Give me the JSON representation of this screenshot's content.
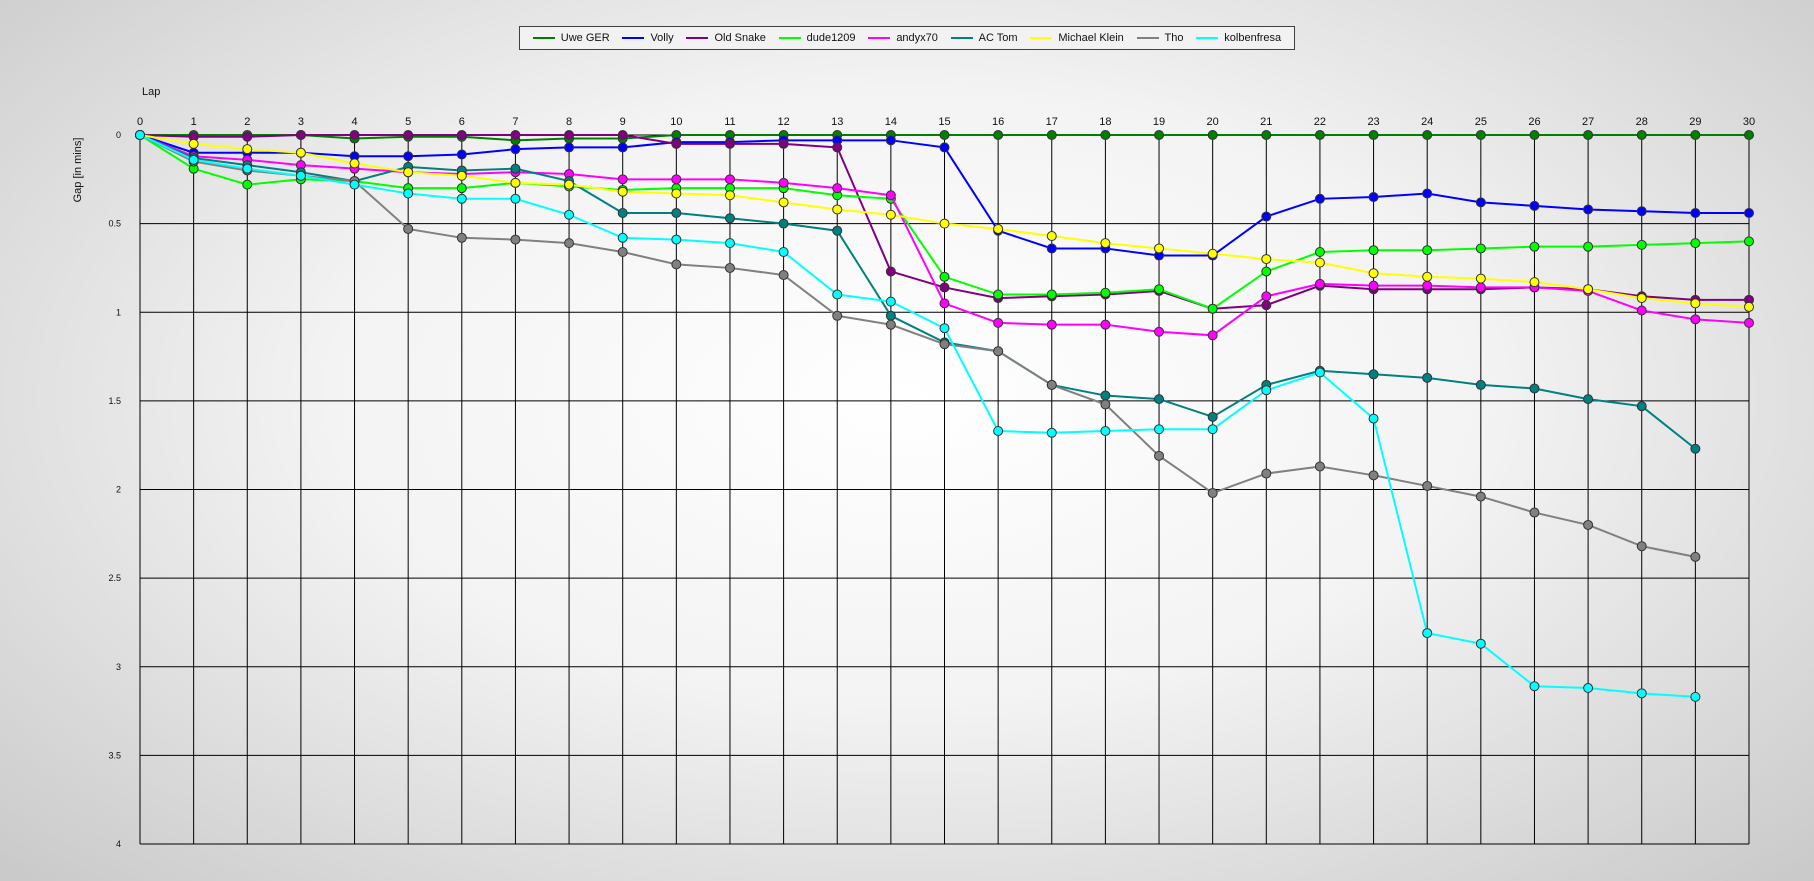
{
  "chart_data": {
    "type": "line",
    "title": "",
    "xlabel": "Lap",
    "ylabel": "Gap [in mins]",
    "x": [
      0,
      1,
      2,
      3,
      4,
      5,
      6,
      7,
      8,
      9,
      10,
      11,
      12,
      13,
      14,
      15,
      16,
      17,
      18,
      19,
      20,
      21,
      22,
      23,
      24,
      25,
      26,
      27,
      28,
      29,
      30
    ],
    "xlim": [
      0,
      30
    ],
    "ylim": [
      0,
      4
    ],
    "y_inverted": true,
    "y_ticks": [
      "0",
      "0.5",
      "1",
      "1.5",
      "2",
      "2.5",
      "3",
      "3.5",
      "4"
    ],
    "grid": true,
    "legend_position": "top-center",
    "series": [
      {
        "name": "Uwe GER",
        "color": "#008000",
        "values": [
          0,
          0,
          0,
          0,
          0.02,
          0.01,
          0.01,
          0.03,
          0.02,
          0.02,
          0,
          0,
          0,
          0,
          0,
          0,
          0,
          0,
          0,
          0,
          0,
          0,
          0,
          0,
          0,
          0,
          0,
          0,
          0,
          0,
          0
        ]
      },
      {
        "name": "Volly",
        "color": "#0000ff",
        "values": [
          0,
          0.1,
          0.1,
          0.1,
          0.12,
          0.12,
          0.11,
          0.08,
          0.07,
          0.07,
          0.04,
          0.04,
          0.03,
          0.03,
          0.03,
          0.07,
          0.54,
          0.64,
          0.64,
          0.68,
          0.68,
          0.46,
          0.36,
          0.35,
          0.33,
          0.38,
          0.4,
          0.42,
          0.43,
          0.44,
          0.44
        ]
      },
      {
        "name": "Old Snake",
        "color": "#800080",
        "values": [
          0,
          0.01,
          0.01,
          0,
          0,
          0,
          0,
          0,
          0,
          0,
          0.05,
          0.05,
          0.05,
          0.07,
          0.77,
          0.86,
          0.92,
          0.91,
          0.9,
          0.88,
          0.98,
          0.96,
          0.85,
          0.87,
          0.87,
          0.87,
          0.86,
          0.87,
          0.91,
          0.93,
          0.93
        ]
      },
      {
        "name": "dude1209",
        "color": "#00ff00",
        "values": [
          0,
          0.19,
          0.28,
          0.25,
          0.26,
          0.3,
          0.3,
          0.27,
          0.29,
          0.31,
          0.3,
          0.3,
          0.3,
          0.34,
          0.36,
          0.8,
          0.9,
          0.9,
          0.89,
          0.87,
          0.98,
          0.77,
          0.66,
          0.65,
          0.65,
          0.64,
          0.63,
          0.63,
          0.62,
          0.61,
          0.6
        ]
      },
      {
        "name": "andyx70",
        "color": "#ff00ff",
        "values": [
          0,
          0.12,
          0.14,
          0.17,
          0.19,
          0.21,
          0.22,
          0.21,
          0.22,
          0.25,
          0.25,
          0.25,
          0.27,
          0.3,
          0.34,
          0.95,
          1.06,
          1.07,
          1.07,
          1.11,
          1.13,
          0.91,
          0.84,
          0.85,
          0.85,
          0.86,
          0.86,
          0.88,
          0.99,
          1.04,
          1.06
        ]
      },
      {
        "name": "AC Tom",
        "color": "#008080",
        "values": [
          0,
          0.13,
          0.17,
          0.21,
          0.26,
          0.18,
          0.2,
          0.19,
          0.26,
          0.44,
          0.44,
          0.47,
          0.5,
          0.54,
          1.02,
          1.17,
          1.22,
          1.41,
          1.47,
          1.49,
          1.59,
          1.41,
          1.33,
          1.35,
          1.37,
          1.41,
          1.43,
          1.49,
          1.53,
          1.77,
          null
        ]
      },
      {
        "name": "Michael Klein",
        "color": "#ffff00",
        "values": [
          0,
          0.05,
          0.08,
          0.1,
          0.16,
          0.21,
          0.23,
          0.27,
          0.28,
          0.32,
          0.33,
          0.34,
          0.38,
          0.42,
          0.45,
          0.5,
          0.53,
          0.57,
          0.61,
          0.64,
          0.67,
          0.7,
          0.72,
          0.78,
          0.8,
          0.81,
          0.83,
          0.87,
          0.92,
          0.95,
          0.97
        ]
      },
      {
        "name": "Tho",
        "color": "#808080",
        "values": [
          0,
          0.15,
          0.2,
          0.23,
          0.26,
          0.53,
          0.58,
          0.59,
          0.61,
          0.66,
          0.73,
          0.75,
          0.79,
          1.02,
          1.07,
          1.18,
          1.22,
          1.41,
          1.52,
          1.81,
          2.02,
          1.91,
          1.87,
          1.92,
          1.98,
          2.04,
          2.13,
          2.2,
          2.32,
          2.38,
          null
        ]
      },
      {
        "name": "kolbenfresa",
        "color": "#00ffff",
        "values": [
          0,
          0.14,
          0.19,
          0.23,
          0.28,
          0.33,
          0.36,
          0.36,
          0.45,
          0.58,
          0.59,
          0.61,
          0.66,
          0.9,
          0.94,
          1.09,
          1.67,
          1.68,
          1.67,
          1.66,
          1.66,
          1.44,
          1.34,
          1.6,
          2.81,
          2.87,
          3.11,
          3.12,
          3.15,
          3.17,
          null
        ]
      }
    ]
  }
}
